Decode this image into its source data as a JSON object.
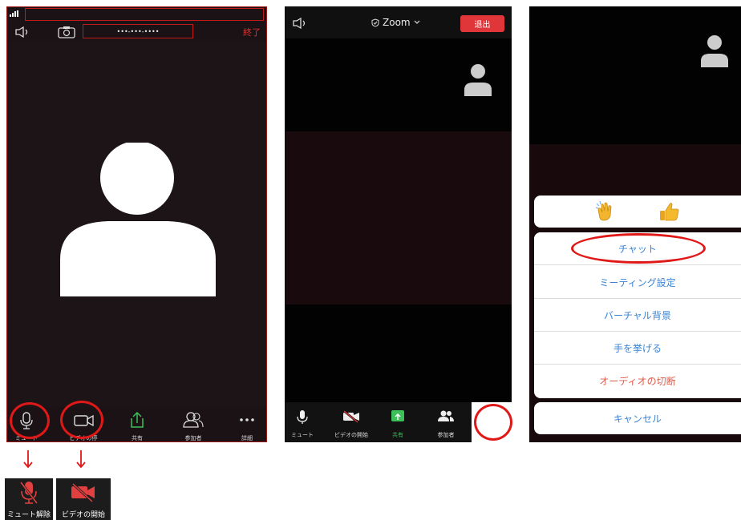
{
  "panel1": {
    "meeting_id": "•••-•••-••••",
    "end_label": "終了",
    "toolbar": {
      "mute": "ミュート",
      "video_stop": "ビデオの停",
      "share": "共有",
      "participants": "参加者",
      "more": "詳細"
    }
  },
  "panel2": {
    "title": "Zoom",
    "leave_label": "退出",
    "toolbar": {
      "mute": "ミュート",
      "video_start": "ビデオの開始",
      "share": "共有",
      "participants": "参加者"
    }
  },
  "panel3": {
    "menu": {
      "chat": "チャット",
      "meeting_settings": "ミーティング設定",
      "virtual_background": "バーチャル背景",
      "raise_hand": "手を挙げる",
      "disconnect_audio": "オーディオの切断",
      "cancel": "キャンセル"
    },
    "reactions": [
      "clap-icon",
      "thumbs-up-icon"
    ]
  },
  "callouts": {
    "unmute_label": "ミュート解除",
    "start_video_label": "ビデオの開始"
  },
  "colors": {
    "accent_red": "#e01818",
    "leave_red": "#e0363a",
    "share_green": "#3dbf5a",
    "menu_blue": "#3a84d6",
    "danger_text": "#e05a4a"
  }
}
